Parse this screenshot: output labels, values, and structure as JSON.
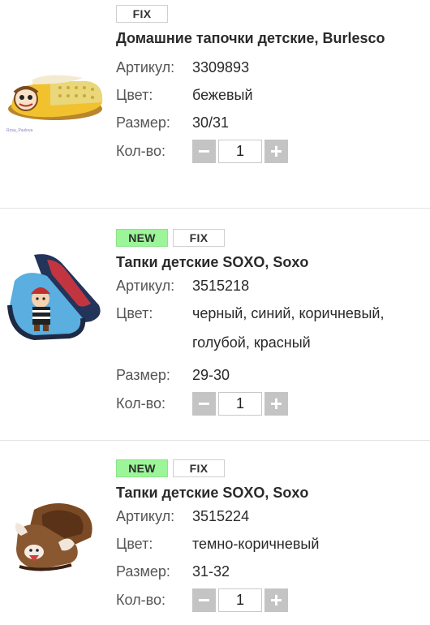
{
  "labels": {
    "article": "Артикул:",
    "color": "Цвет:",
    "size": "Размер:",
    "quantity": "Кол-во:",
    "minus": "−",
    "plus": "+"
  },
  "products": [
    {
      "badges": [
        "FIX"
      ],
      "title": "Домашние тапочки детские, Burlesco",
      "article": "3309893",
      "color": "бежевый",
      "size": "30/31",
      "quantity": "1",
      "image": "slipper-yellow-image"
    },
    {
      "badges": [
        "NEW",
        "FIX"
      ],
      "title": "Тапки детские SOXO, Soxo",
      "article": "3515218",
      "color_lines": [
        "черный, синий, коричневый,",
        "голубой, красный"
      ],
      "size": "29-30",
      "quantity": "1",
      "image": "slipper-pirate-image"
    },
    {
      "badges": [
        "NEW",
        "FIX"
      ],
      "title": "Тапки детские SOXO, Soxo",
      "article": "3515224",
      "color": "темно-коричневый",
      "size": "31-32",
      "quantity": "1",
      "image": "slipper-brown-image"
    }
  ]
}
